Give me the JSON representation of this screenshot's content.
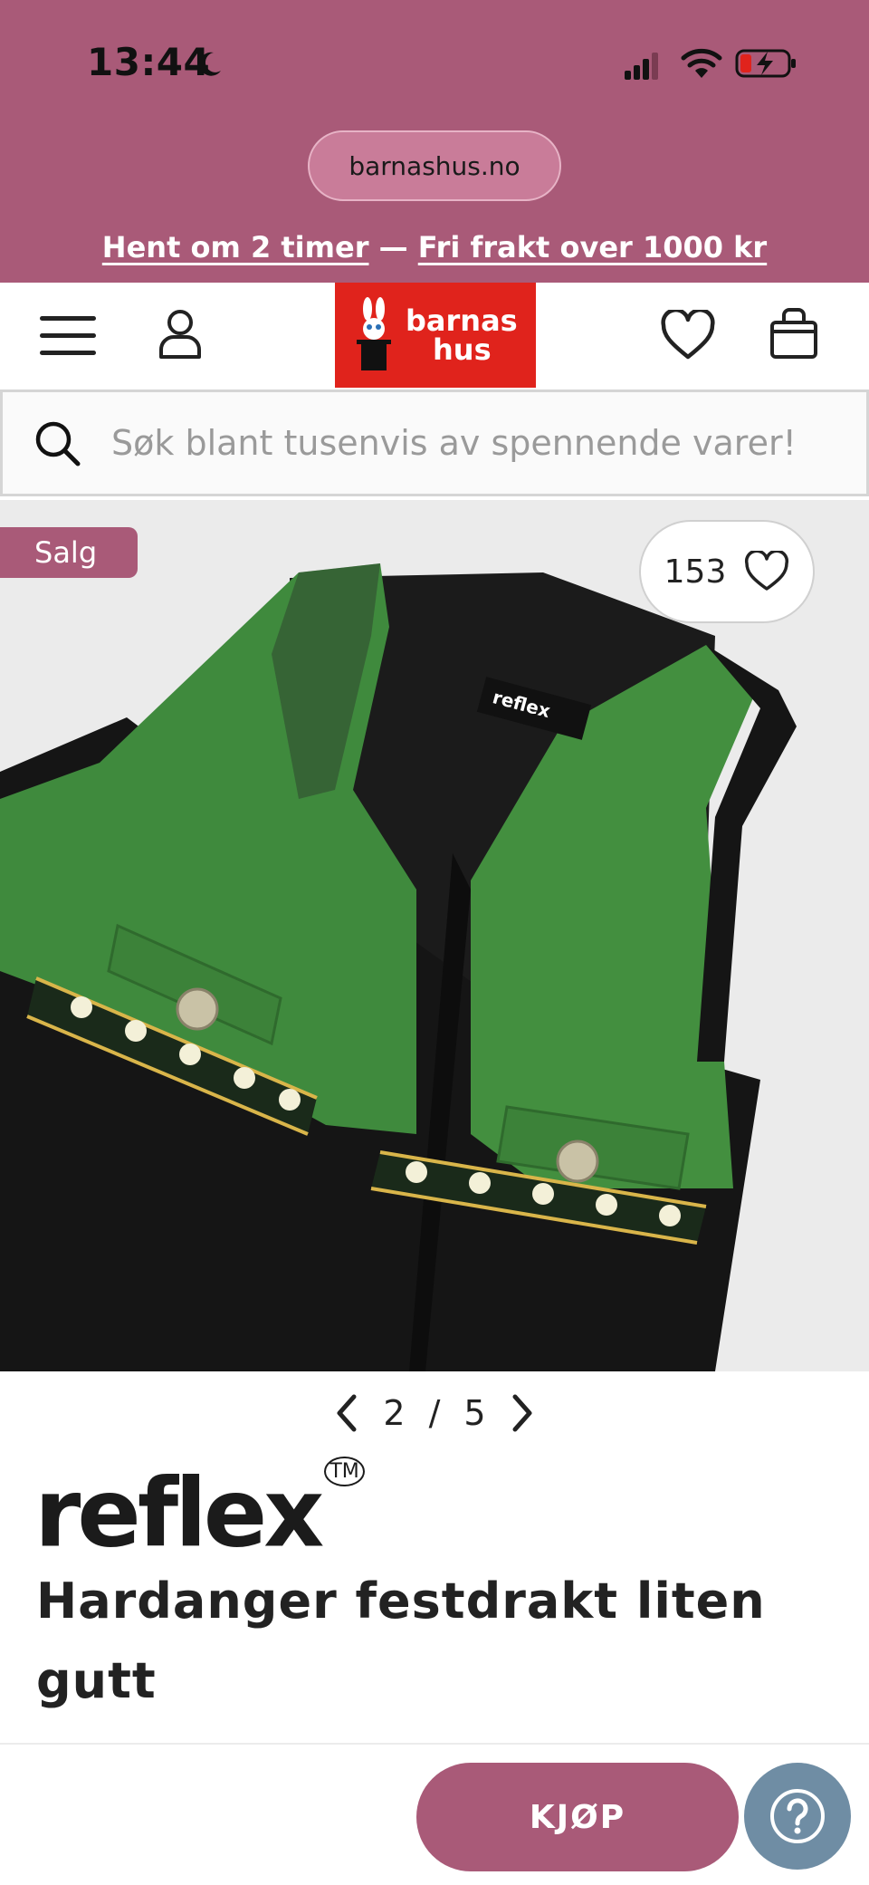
{
  "status_bar": {
    "time": "13:44"
  },
  "browser": {
    "url": "barnashus.no"
  },
  "promo": {
    "pickup": "Hent om 2 timer",
    "separator": " — ",
    "shipping": "Fri frakt over 1000 kr"
  },
  "header": {
    "logo_line1": "barnas",
    "logo_line2": "hus"
  },
  "search": {
    "placeholder": "Søk blant tusenvis av spennende varer!"
  },
  "product": {
    "sale_badge": "Salg",
    "like_count": "153",
    "image_index": "2",
    "image_separator": "/",
    "image_total": "5",
    "brand": "reflex",
    "brand_tm": "TM",
    "title": "Hardanger festdrakt liten gutt"
  },
  "actions": {
    "buy_label": "KJØP"
  },
  "colors": {
    "brand_pink": "#a95a78",
    "logo_red": "#e0231c",
    "help_blue": "#6f8da4"
  }
}
